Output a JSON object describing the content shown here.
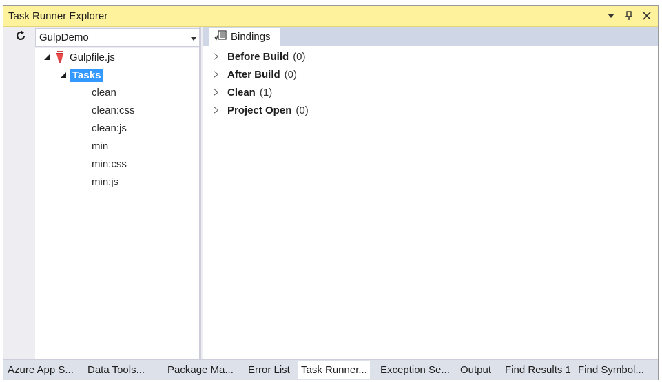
{
  "window": {
    "title": "Task Runner Explorer"
  },
  "toolbar": {
    "project_selected": "GulpDemo"
  },
  "tree": {
    "root": {
      "label": "Gulpfile.js",
      "icon": "gulp-icon"
    },
    "group": {
      "label": "Tasks"
    },
    "tasks": [
      "clean",
      "clean:css",
      "clean:js",
      "min",
      "min:css",
      "min:js"
    ]
  },
  "bindings_tab": {
    "label": "Bindings"
  },
  "bindings": [
    {
      "name": "Before Build",
      "count": "(0)"
    },
    {
      "name": "After Build",
      "count": "(0)"
    },
    {
      "name": "Clean",
      "count": "(1)"
    },
    {
      "name": "Project Open",
      "count": "(0)"
    }
  ],
  "bottom_tabs": [
    "Azure App S...",
    "Data Tools...",
    "Package Ma...",
    "Error List",
    "Task Runner...",
    "Exception Se...",
    "Output",
    "Find Results 1",
    "Find Symbol..."
  ],
  "colors": {
    "title_bar": "#fff29d",
    "selection": "#3399ff",
    "tab_strip": "#cfd6e5"
  }
}
